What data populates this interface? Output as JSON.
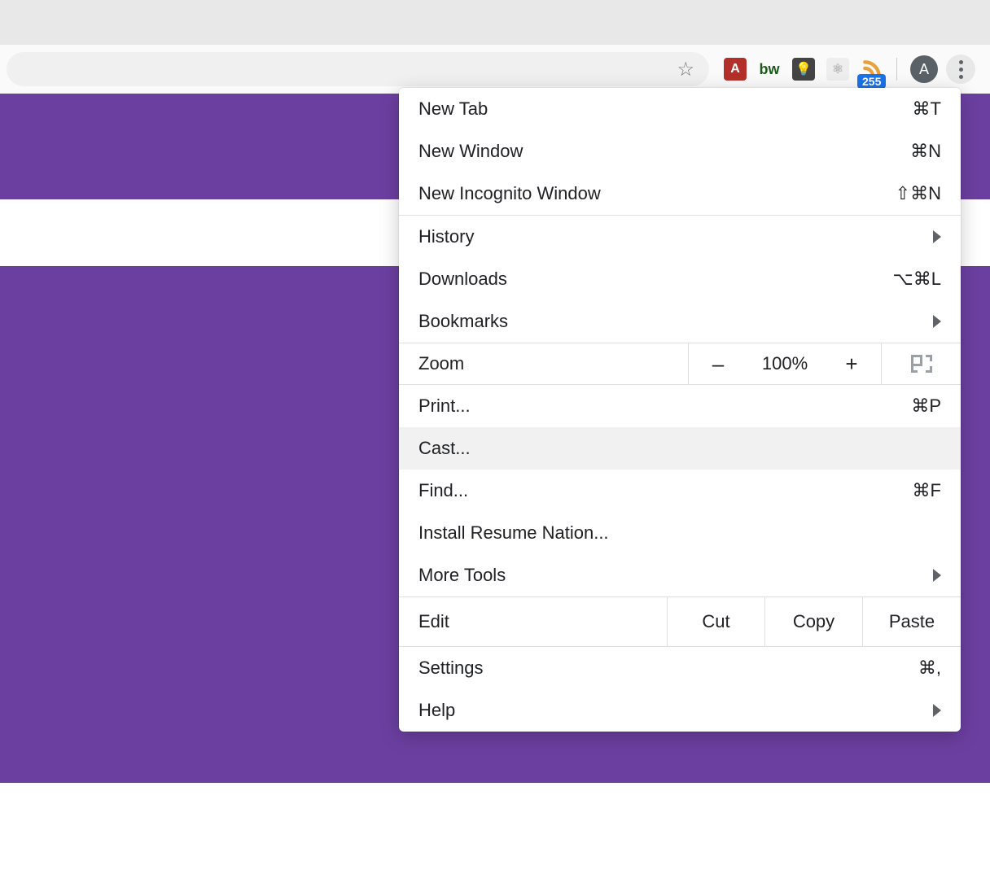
{
  "toolbar": {
    "avatar_initial": "A",
    "rss_badge": "255"
  },
  "menu": {
    "new_tab": {
      "label": "New Tab",
      "shortcut": "⌘T"
    },
    "new_window": {
      "label": "New Window",
      "shortcut": "⌘N"
    },
    "new_incognito": {
      "label": "New Incognito Window",
      "shortcut": "⇧⌘N"
    },
    "history": {
      "label": "History"
    },
    "downloads": {
      "label": "Downloads",
      "shortcut": "⌥⌘L"
    },
    "bookmarks": {
      "label": "Bookmarks"
    },
    "zoom": {
      "label": "Zoom",
      "value": "100%",
      "minus": "–",
      "plus": "+"
    },
    "print": {
      "label": "Print...",
      "shortcut": "⌘P"
    },
    "cast": {
      "label": "Cast..."
    },
    "find": {
      "label": "Find...",
      "shortcut": "⌘F"
    },
    "install": {
      "label": "Install Resume Nation..."
    },
    "more_tools": {
      "label": "More Tools"
    },
    "edit": {
      "label": "Edit",
      "cut": "Cut",
      "copy": "Copy",
      "paste": "Paste"
    },
    "settings": {
      "label": "Settings",
      "shortcut": "⌘,"
    },
    "help": {
      "label": "Help"
    }
  }
}
